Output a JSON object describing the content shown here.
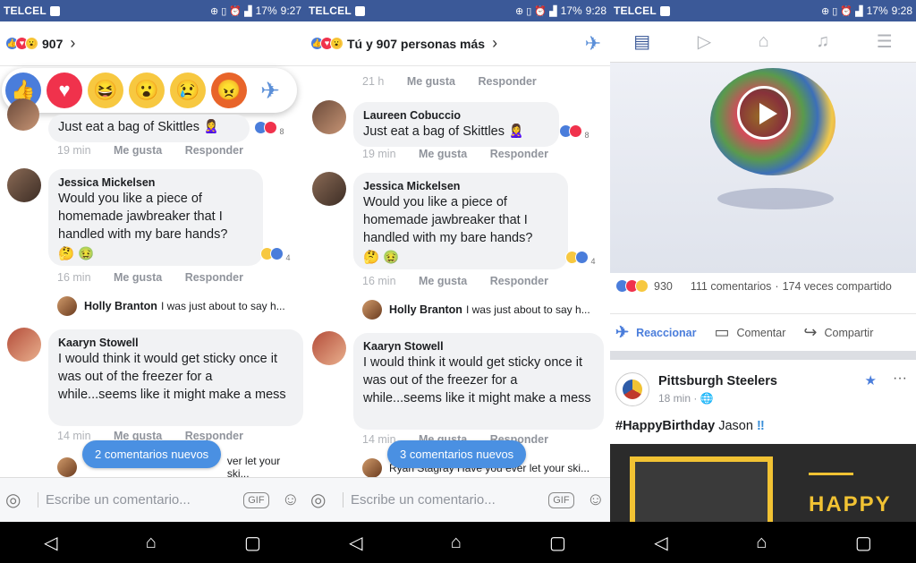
{
  "status": [
    {
      "carrier": "TELCEL",
      "battery": "17%",
      "time": "9:27"
    },
    {
      "carrier": "TELCEL",
      "battery": "17%",
      "time": "9:28"
    },
    {
      "carrier": "TELCEL",
      "battery": "17%",
      "time": "9:28"
    }
  ],
  "panel1": {
    "reaction_count": "907",
    "comments": [
      {
        "name": "",
        "text": "Just eat a bag of Skittles 🙎‍♀️",
        "time": "19 min",
        "like": "Me gusta",
        "reply": "Responder",
        "rx": "8"
      },
      {
        "name": "Jessica Mickelsen",
        "text": "Would you like a piece of homemade jawbreaker that I handled with my bare hands?",
        "time": "16 min",
        "like": "Me gusta",
        "reply": "Responder",
        "rx": "4"
      },
      {
        "name": "Kaaryn Stowell",
        "text": "I would think it would get sticky once it was out of the freezer for a while...seems like it might make a mess",
        "time": "14 min",
        "like": "Me gusta",
        "reply": "Responder"
      }
    ],
    "reply_preview": {
      "name": "Holly Branton",
      "text": "I was just about to say h..."
    },
    "reply_preview2": "ver let your ski...",
    "new_pill": "2 comentarios nuevos",
    "composer": "Escribe un comentario...",
    "gif": "GIF"
  },
  "panel2": {
    "reaction_text": "Tú y 907 personas más",
    "top_time": "21 h",
    "comments": [
      {
        "name": "Laureen Cobuccio",
        "text": "Just eat a bag of Skittles 🙎‍♀️",
        "time": "19 min",
        "like": "Me gusta",
        "reply": "Responder",
        "rx": "8"
      },
      {
        "name": "Jessica Mickelsen",
        "text": "Would you like a piece of homemade jawbreaker that I handled with my bare hands?",
        "time": "16 min",
        "like": "Me gusta",
        "reply": "Responder",
        "rx": "4"
      },
      {
        "name": "Kaaryn Stowell",
        "text": "I would think it would get sticky once it was out of the freezer for a while...seems like it might make a mess",
        "time": "14 min",
        "like": "Me gusta",
        "reply": "Responder"
      }
    ],
    "reply_preview": {
      "name": "Holly Branton",
      "text": "I was just about to say h..."
    },
    "reply_preview2": "Ryan Stagray  Have you ever let your ski...",
    "new_pill": "3 comentarios nuevos",
    "composer": "Escribe un comentario...",
    "gif": "GIF"
  },
  "panel3": {
    "reaction_count": "930",
    "comments_count": "111 comentarios",
    "shares": "174 veces compartido",
    "react_label": "Reaccionar",
    "comment_label": "Comentar",
    "share_label": "Compartir",
    "page_name": "Pittsburgh Steelers",
    "post_time": "18 min · 🌐",
    "hashtag": "#HappyBirthday",
    "post_name": "Jason",
    "banner_text": "HAPPY"
  },
  "colors": {
    "brand": "#3b5998",
    "accent": "#4a7ddb",
    "pill": "#4a90e2"
  }
}
